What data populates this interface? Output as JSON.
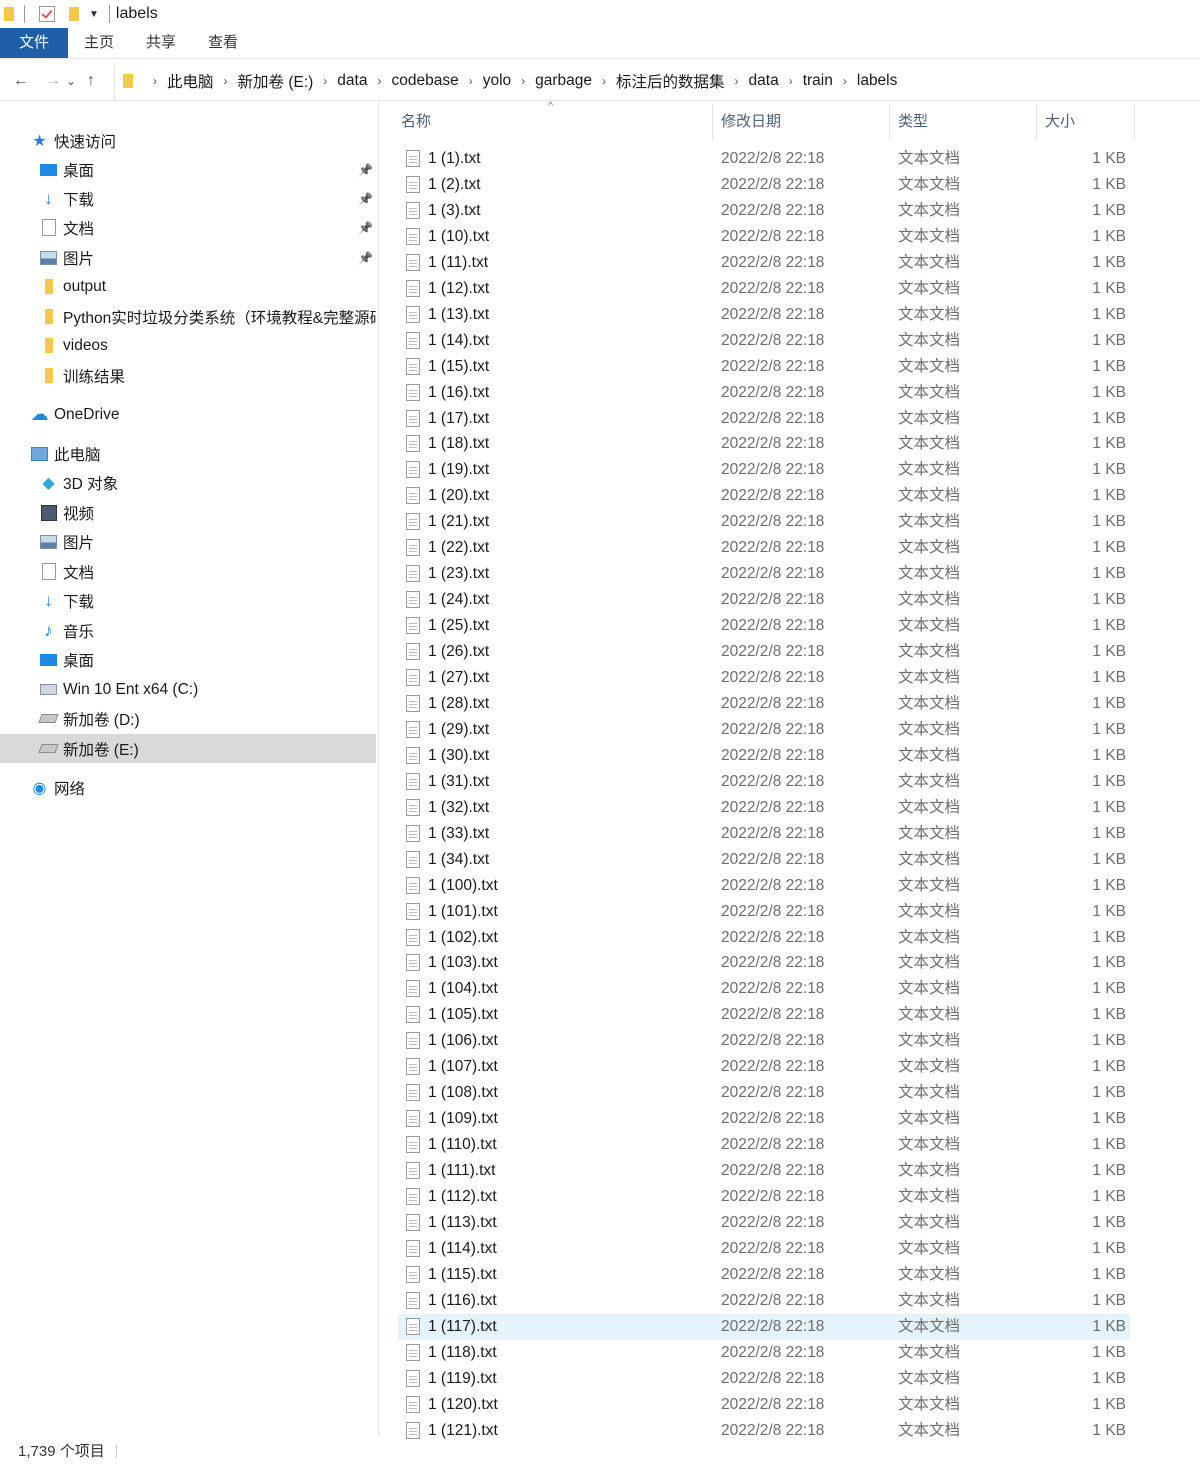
{
  "window": {
    "title": "labels"
  },
  "ribbon": {
    "tabs": [
      "文件",
      "主页",
      "共享",
      "查看"
    ]
  },
  "nav_buttons": {
    "back": "←",
    "forward": "→",
    "recent": "⌄",
    "up": "↑"
  },
  "breadcrumb": [
    "此电脑",
    "新加卷 (E:)",
    "data",
    "codebase",
    "yolo",
    "garbage",
    "标注后的数据集",
    "data",
    "train",
    "labels"
  ],
  "sidebar": {
    "items": [
      {
        "label": "快速访问",
        "icon": "star-icon",
        "indent": false,
        "pinned": false
      },
      {
        "label": "桌面",
        "icon": "desktop-icon",
        "indent": true,
        "pinned": true
      },
      {
        "label": "下载",
        "icon": "download-icon",
        "indent": true,
        "pinned": true
      },
      {
        "label": "文档",
        "icon": "document-icon",
        "indent": true,
        "pinned": true
      },
      {
        "label": "图片",
        "icon": "pictures-icon",
        "indent": true,
        "pinned": true
      },
      {
        "label": "output",
        "icon": "folder-icon",
        "indent": true,
        "pinned": false
      },
      {
        "label": "Python实时垃圾分类系统（环境教程&完整源码",
        "icon": "folder-icon",
        "indent": true,
        "pinned": false
      },
      {
        "label": "videos",
        "icon": "folder-icon",
        "indent": true,
        "pinned": false
      },
      {
        "label": "训练结果",
        "icon": "folder-icon",
        "indent": true,
        "pinned": false
      },
      {
        "label": "OneDrive",
        "icon": "onedrive-cloud-icon",
        "indent": false,
        "pinned": false
      },
      {
        "label": "此电脑",
        "icon": "this-pc-icon",
        "indent": false,
        "pinned": false
      },
      {
        "label": "3D 对象",
        "icon": "3d-objects-icon",
        "indent": true,
        "pinned": false
      },
      {
        "label": "视频",
        "icon": "videos-icon",
        "indent": true,
        "pinned": false
      },
      {
        "label": "图片",
        "icon": "pictures-icon",
        "indent": true,
        "pinned": false
      },
      {
        "label": "文档",
        "icon": "document-icon",
        "indent": true,
        "pinned": false
      },
      {
        "label": "下载",
        "icon": "download-icon",
        "indent": true,
        "pinned": false
      },
      {
        "label": "音乐",
        "icon": "music-icon",
        "indent": true,
        "pinned": false
      },
      {
        "label": "桌面",
        "icon": "desktop-icon",
        "indent": true,
        "pinned": false
      },
      {
        "label": "Win 10 Ent x64 (C:)",
        "icon": "windows-drive-icon",
        "indent": true,
        "pinned": false
      },
      {
        "label": "新加卷 (D:)",
        "icon": "drive-icon",
        "indent": true,
        "pinned": false
      },
      {
        "label": "新加卷 (E:)",
        "icon": "drive-icon",
        "indent": true,
        "pinned": false,
        "selected": true
      },
      {
        "label": "网络",
        "icon": "network-icon",
        "indent": false,
        "pinned": false
      }
    ]
  },
  "columns": {
    "name": "名称",
    "modified": "修改日期",
    "type": "类型",
    "size": "大小"
  },
  "files": {
    "date": "2022/2/8 22:18",
    "type": "文本文档",
    "size": "1 KB",
    "highlighted": "1 (117).txt",
    "names": [
      "1 (1).txt",
      "1 (2).txt",
      "1 (3).txt",
      "1 (10).txt",
      "1 (11).txt",
      "1 (12).txt",
      "1 (13).txt",
      "1 (14).txt",
      "1 (15).txt",
      "1 (16).txt",
      "1 (17).txt",
      "1 (18).txt",
      "1 (19).txt",
      "1 (20).txt",
      "1 (21).txt",
      "1 (22).txt",
      "1 (23).txt",
      "1 (24).txt",
      "1 (25).txt",
      "1 (26).txt",
      "1 (27).txt",
      "1 (28).txt",
      "1 (29).txt",
      "1 (30).txt",
      "1 (31).txt",
      "1 (32).txt",
      "1 (33).txt",
      "1 (34).txt",
      "1 (100).txt",
      "1 (101).txt",
      "1 (102).txt",
      "1 (103).txt",
      "1 (104).txt",
      "1 (105).txt",
      "1 (106).txt",
      "1 (107).txt",
      "1 (108).txt",
      "1 (109).txt",
      "1 (110).txt",
      "1 (111).txt",
      "1 (112).txt",
      "1 (113).txt",
      "1 (114).txt",
      "1 (115).txt",
      "1 (116).txt",
      "1 (117).txt",
      "1 (118).txt",
      "1 (119).txt",
      "1 (120).txt",
      "1 (121).txt"
    ]
  },
  "status": {
    "count": "1,739 个项目"
  },
  "colors": {
    "file_tab": "#1f5fa8",
    "accent": "#1e88e5",
    "selected_nav": "#d9d9d9",
    "hover_row": "#e5f3fb"
  }
}
